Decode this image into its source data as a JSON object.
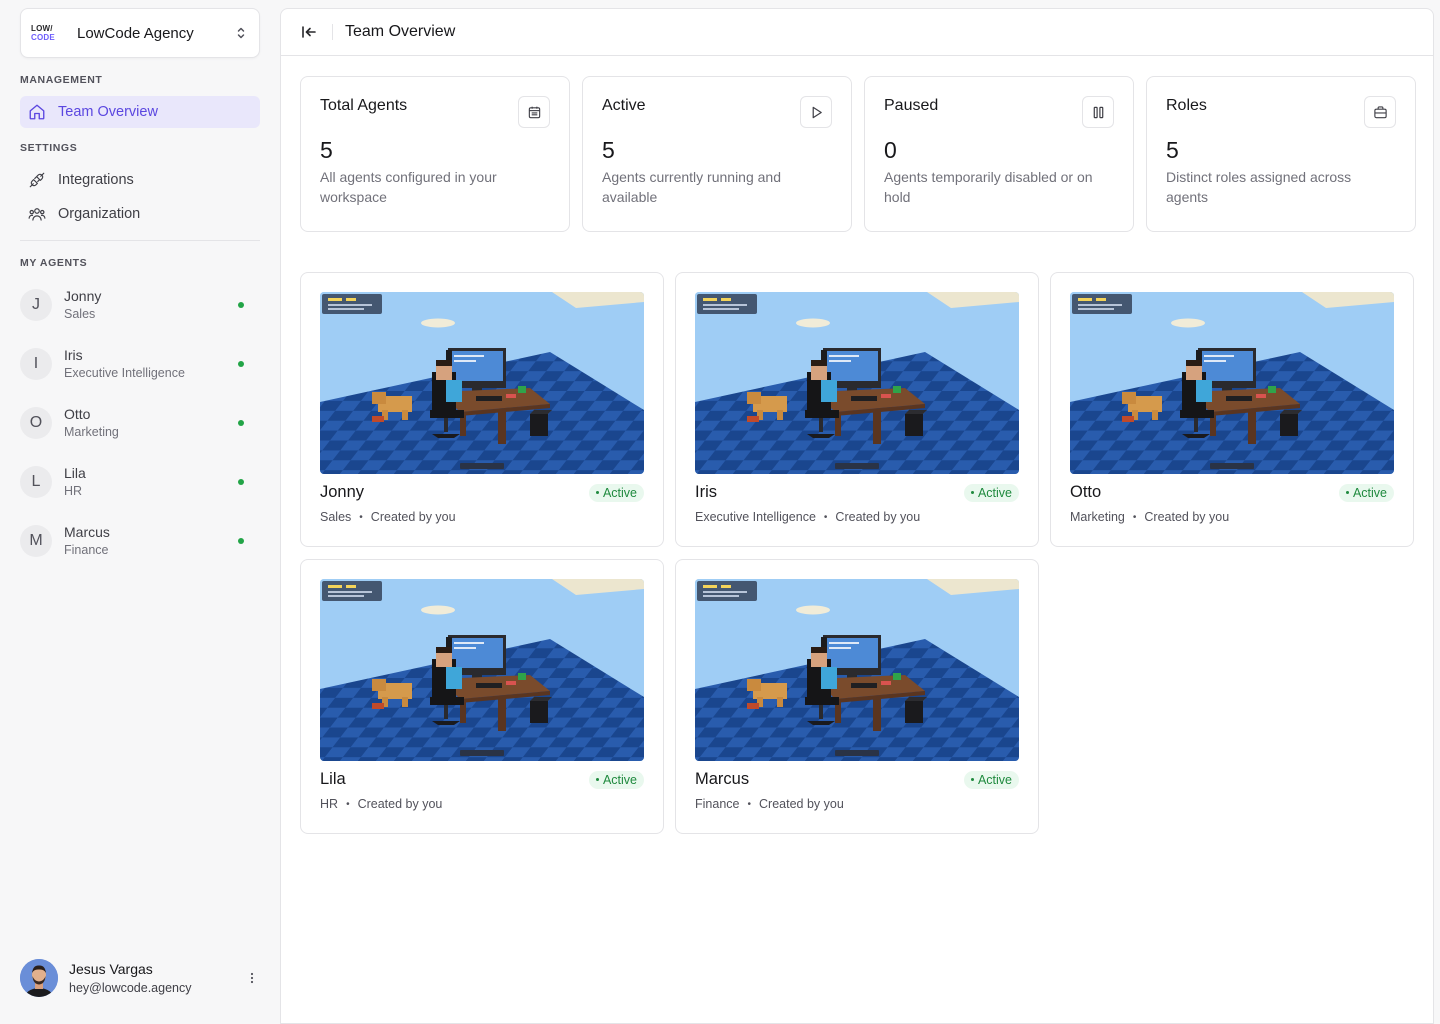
{
  "org": {
    "logo_line1": "LOW/",
    "logo_line2": "CODE",
    "name": "LowCode Agency",
    "switcher_icon": "chevrons-up-down-icon"
  },
  "sidebar": {
    "management_label": "MANAGEMENT",
    "settings_label": "SETTINGS",
    "my_agents_label": "MY AGENTS",
    "nav": {
      "team_overview": "Team Overview",
      "integrations": "Integrations",
      "organization": "Organization"
    },
    "agents": [
      {
        "initial": "J",
        "name": "Jonny",
        "role": "Sales"
      },
      {
        "initial": "I",
        "name": "Iris",
        "role": "Executive Intelligence"
      },
      {
        "initial": "O",
        "name": "Otto",
        "role": "Marketing"
      },
      {
        "initial": "L",
        "name": "Lila",
        "role": "HR"
      },
      {
        "initial": "M",
        "name": "Marcus",
        "role": "Finance"
      }
    ]
  },
  "user": {
    "name": "Jesus Vargas",
    "email": "hey@lowcode.agency"
  },
  "header": {
    "title": "Team Overview"
  },
  "stats": [
    {
      "title": "Total Agents",
      "value": "5",
      "desc": "All agents configured in your workspace",
      "icon": "calendar-icon"
    },
    {
      "title": "Active",
      "value": "5",
      "desc": "Agents currently running and available",
      "icon": "play-icon"
    },
    {
      "title": "Paused",
      "value": "0",
      "desc": "Agents temporarily disabled or on hold",
      "icon": "pause-icon"
    },
    {
      "title": "Roles",
      "value": "5",
      "desc": "Distinct roles assigned across agents",
      "icon": "briefcase-icon"
    }
  ],
  "cards": [
    {
      "name": "Jonny",
      "role": "Sales",
      "status": "Active",
      "created": "Created by you"
    },
    {
      "name": "Iris",
      "role": "Executive Intelligence",
      "status": "Active",
      "created": "Created by you"
    },
    {
      "name": "Otto",
      "role": "Marketing",
      "status": "Active",
      "created": "Created by you"
    },
    {
      "name": "Lila",
      "role": "HR",
      "status": "Active",
      "created": "Created by you"
    },
    {
      "name": "Marcus",
      "role": "Finance",
      "status": "Active",
      "created": "Created by you"
    }
  ],
  "colors": {
    "accent": "#5b47e0",
    "accent_bg": "#e9e7fb",
    "status_green": "#22a447",
    "badge_bg": "#e9f8ee"
  }
}
